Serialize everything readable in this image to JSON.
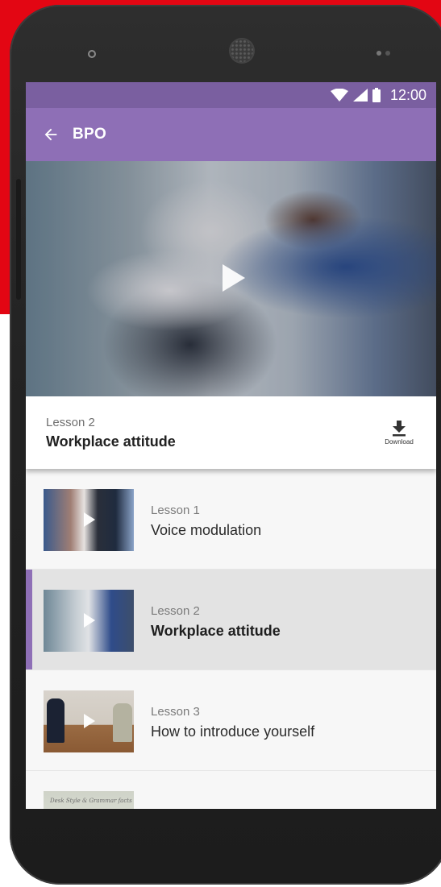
{
  "status_bar": {
    "time": "12:00"
  },
  "app_bar": {
    "title": "BPO"
  },
  "current_lesson": {
    "number": "Lesson 2",
    "title": "Workplace attitude",
    "download_label": "Download"
  },
  "lessons": [
    {
      "number": "Lesson 1",
      "title": "Voice modulation",
      "active": false
    },
    {
      "number": "Lesson 2",
      "title": "Workplace attitude",
      "active": true
    },
    {
      "number": "Lesson 3",
      "title": "How to introduce yourself",
      "active": false
    }
  ],
  "partial_thumb_text": "Desk Style & Grammar facts",
  "colors": {
    "brand_red": "#e30613",
    "status_bar": "#7a5fa0",
    "app_bar": "#8e6fb6",
    "active_indicator": "#8e6fb6"
  }
}
